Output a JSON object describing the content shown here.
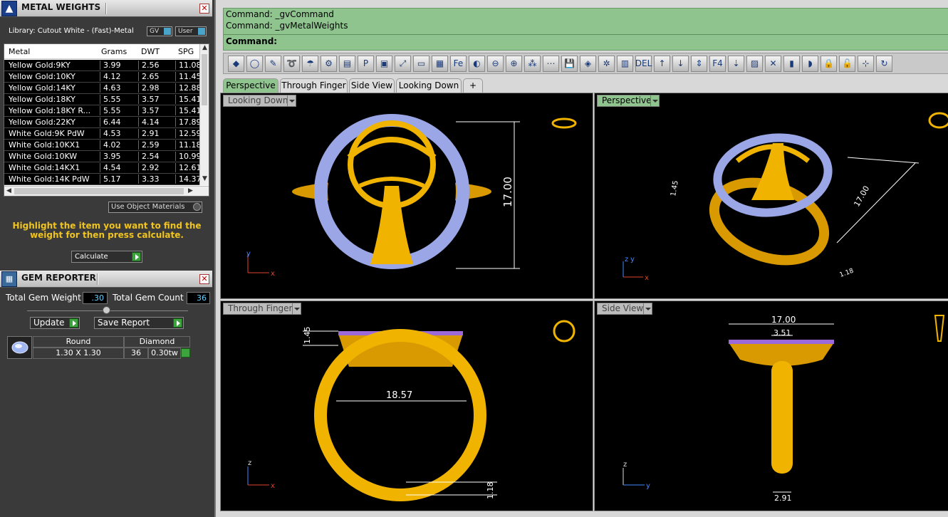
{
  "metal_panel": {
    "title": "METAL WEIGHTS",
    "library": "Library: Cutout White - (Fast)-Metal",
    "gv": "GV",
    "user": "User",
    "columns": [
      "Metal",
      "Grams",
      "DWT",
      "SPG"
    ],
    "rows": [
      {
        "metal": "Yellow Gold:9KY",
        "grams": "3.99",
        "dwt": "2.56",
        "spg": "11.08"
      },
      {
        "metal": "Yellow Gold:10KY",
        "grams": "4.12",
        "dwt": "2.65",
        "spg": "11.45"
      },
      {
        "metal": "Yellow Gold:14KY",
        "grams": "4.63",
        "dwt": "2.98",
        "spg": "12.88"
      },
      {
        "metal": "Yellow Gold:18KY",
        "grams": "5.55",
        "dwt": "3.57",
        "spg": "15.41"
      },
      {
        "metal": "Yellow Gold:18KY R...",
        "grams": "5.55",
        "dwt": "3.57",
        "spg": "15.41"
      },
      {
        "metal": "Yellow Gold:22KY",
        "grams": "6.44",
        "dwt": "4.14",
        "spg": "17.89"
      },
      {
        "metal": "White Gold:9K PdW",
        "grams": "4.53",
        "dwt": "2.91",
        "spg": "12.59"
      },
      {
        "metal": "White Gold:10KX1",
        "grams": "4.02",
        "dwt": "2.59",
        "spg": "11.18"
      },
      {
        "metal": "White Gold:10KW",
        "grams": "3.95",
        "dwt": "2.54",
        "spg": "10.99"
      },
      {
        "metal": "White Gold:14KX1",
        "grams": "4.54",
        "dwt": "2.92",
        "spg": "12.61"
      },
      {
        "metal": "White Gold:14K PdW",
        "grams": "5.17",
        "dwt": "3.33",
        "spg": "14.37"
      }
    ],
    "use_object_materials": "Use Object Materials",
    "hint": "Highlight the item you want to find the weight for then press calculate.",
    "calculate": "Calculate"
  },
  "gem_panel": {
    "title": "GEM REPORTER",
    "total_weight_label": "Total Gem Weight",
    "total_weight_value": ".30",
    "total_count_label": "Total Gem Count",
    "total_count_value": "36",
    "update": "Update",
    "save_report": "Save Report",
    "gem": {
      "shape": "Round",
      "type": "Diamond",
      "size": "1.30 X 1.30",
      "count": "36",
      "weight": "0.30tw"
    }
  },
  "command": {
    "line1": "Command:  _gvCommand",
    "line2": "Command:  _gvMetalWeights",
    "prompt": "Command:"
  },
  "toolbar_icons": [
    "gem-tool",
    "ring-tool",
    "pin-tool",
    "shank-tool",
    "bail-tool",
    "prong-tool",
    "pave-tool",
    "render-tool",
    "measure-tool",
    "monitor-tool",
    "box-tool",
    "text-tool",
    "mirror-tool",
    "array-tool",
    "radial-tool",
    "molecule-tool",
    "network-tool",
    "save-tool",
    "cube-tool",
    "gear-tool",
    "layout-tool",
    "del-tool",
    "up-arrow-tool",
    "down-arrow-tool",
    "updown-tool",
    "f4-tool",
    "snap-tool",
    "grid-tool",
    "cross-tool",
    "cylinder-tool",
    "bend-tool",
    "lock-tool",
    "unlock-tool",
    "axis-tool",
    "orbit-tool",
    "person-tool"
  ],
  "tabs": [
    "Perspective",
    "Through Finger",
    "Side View",
    "Looking Down"
  ],
  "viewports": {
    "top_left": {
      "label": "Looking Down",
      "dim": "17.00"
    },
    "top_right": {
      "label": "Perspective",
      "dim_a": "17.00",
      "dim_b": "1.45",
      "dim_c": "1.18"
    },
    "bottom_left": {
      "label": "Through Finger",
      "dim_a": "1.45",
      "dim_b": "18.57",
      "dim_c": "1.18"
    },
    "bottom_right": {
      "label": "Side View",
      "dim_a": "17.00",
      "dim_b": "3.51",
      "dim_c": "2.91"
    }
  },
  "colors": {
    "gold": "#f0b400",
    "gem": "#8fa8f0",
    "command_bg": "#8fc48f"
  }
}
